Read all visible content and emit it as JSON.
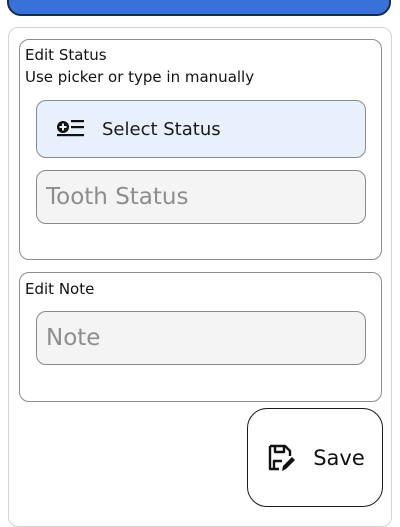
{
  "status_card": {
    "title": "Edit Status",
    "subtitle": "Use picker or type in manually",
    "picker_label": "Select Status",
    "picker_icon": "list-add-icon",
    "input_placeholder": "Tooth Status",
    "input_value": ""
  },
  "note_card": {
    "title": "Edit Note",
    "input_placeholder": "Note",
    "input_value": ""
  },
  "save": {
    "label": "Save",
    "icon": "save-edit-icon"
  },
  "colors": {
    "header": "#3872d8",
    "picker_bg": "#e8f0fb",
    "field_bg": "#f4f4f4"
  }
}
